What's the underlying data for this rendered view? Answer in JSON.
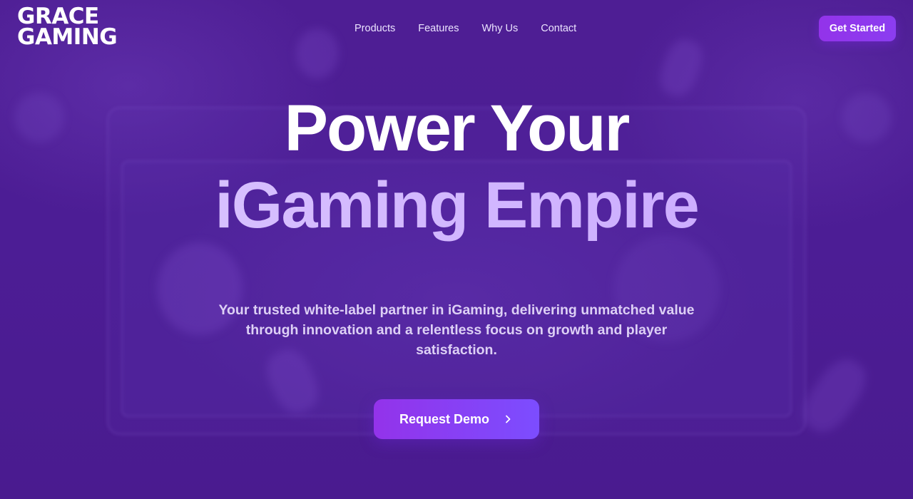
{
  "brand": {
    "logo_line1": "GRACE",
    "logo_line2": "GAMING"
  },
  "nav": {
    "items": [
      {
        "label": "Products"
      },
      {
        "label": "Features"
      },
      {
        "label": "Why Us"
      },
      {
        "label": "Contact"
      }
    ],
    "cta_label": "Get Started"
  },
  "hero": {
    "title_line1": "Power Your",
    "title_line2": "iGaming Empire",
    "subtitle": "Your trusted white-label partner in iGaming, delivering unmatched value through innovation and a relentless focus on growth and player satisfaction.",
    "cta_label": "Request Demo",
    "cta_icon": "chevron-right-icon"
  },
  "colors": {
    "background": "#4c1d95",
    "accent": "#9333ea",
    "headline_gradient": "#d1b8ff"
  }
}
